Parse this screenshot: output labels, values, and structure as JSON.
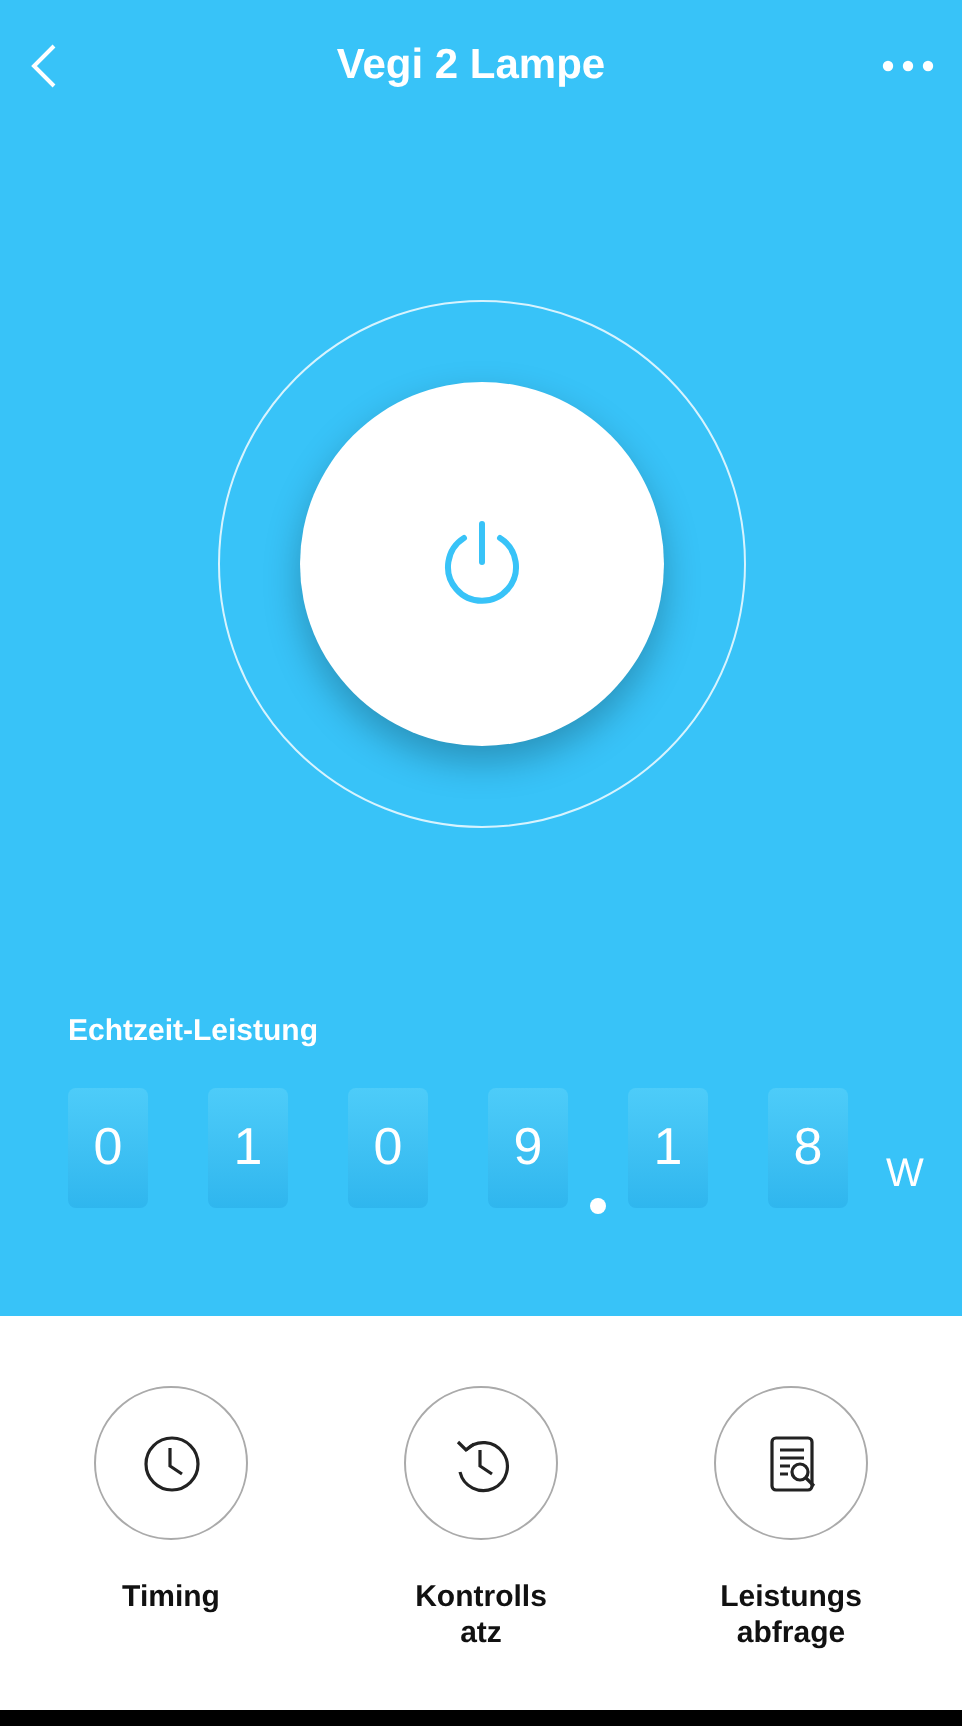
{
  "header": {
    "title": "Vegi 2 Lampe"
  },
  "power": {
    "label": "Echtzeit-Leistung",
    "unit": "W",
    "digits": [
      {
        "kind": "digit",
        "text": "0"
      },
      {
        "kind": "digit",
        "text": "1"
      },
      {
        "kind": "digit",
        "text": "0"
      },
      {
        "kind": "digit",
        "text": "9"
      },
      {
        "kind": "point"
      },
      {
        "kind": "digit",
        "text": "1"
      },
      {
        "kind": "digit",
        "text": "8"
      }
    ]
  },
  "actions": [
    {
      "kind": "timer",
      "label": "Timing"
    },
    {
      "kind": "history",
      "label": "Kontrolls atz"
    },
    {
      "kind": "report",
      "label": "Leistungs abfrage"
    }
  ]
}
